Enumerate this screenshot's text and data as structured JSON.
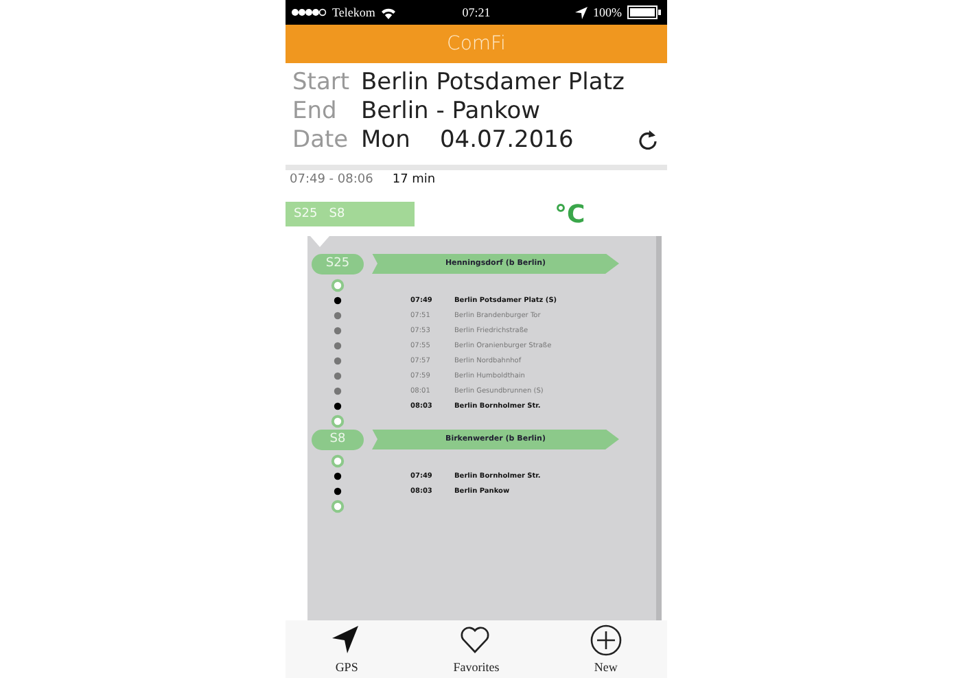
{
  "status_bar": {
    "carrier": "Telekom",
    "time": "07:21",
    "battery": "100%"
  },
  "header": {
    "title": "ComFi"
  },
  "trip": [
    {
      "label": "Start",
      "value": "Berlin Potsdamer Platz"
    },
    {
      "label": "End",
      "value": "Berlin - Pankow"
    },
    {
      "label": "Date",
      "value": "Mon    04.07.2016"
    }
  ],
  "summary": {
    "times": "07:49 - 08:06",
    "duration": "17 min"
  },
  "route_tag": {
    "lines": "S25   S8",
    "unit": "°C"
  },
  "segments": [
    {
      "line": "S25",
      "destination": "Henningsdorf (b Berlin)",
      "stops": [
        {
          "time": "07:49",
          "name": "Berlin Potsdamer Platz (S)",
          "major": true
        },
        {
          "time": "07:51",
          "name": "Berlin Brandenburger Tor",
          "major": false
        },
        {
          "time": "07:53",
          "name": "Berlin Friedrichstraße",
          "major": false
        },
        {
          "time": "07:55",
          "name": "Berlin Oranienburger Straße",
          "major": false
        },
        {
          "time": "07:57",
          "name": "Berlin Nordbahnhof",
          "major": false
        },
        {
          "time": "07:59",
          "name": "Berlin Humboldthain",
          "major": false
        },
        {
          "time": "08:01",
          "name": "Berlin Gesundbrunnen (S)",
          "major": false
        },
        {
          "time": "08:03",
          "name": "Berlin Bornholmer Str.",
          "major": true
        }
      ]
    },
    {
      "line": "S8",
      "destination": "Birkenwerder (b Berlin)",
      "stops": [
        {
          "time": "07:49",
          "name": "Berlin Bornholmer Str.",
          "major": true
        },
        {
          "time": "08:03",
          "name": "Berlin Pankow",
          "major": true
        }
      ]
    }
  ],
  "tab_bar": [
    {
      "label": "GPS",
      "kind": "gps"
    },
    {
      "label": "Favorites",
      "kind": "favorites"
    },
    {
      "label": "New",
      "kind": "new"
    }
  ]
}
